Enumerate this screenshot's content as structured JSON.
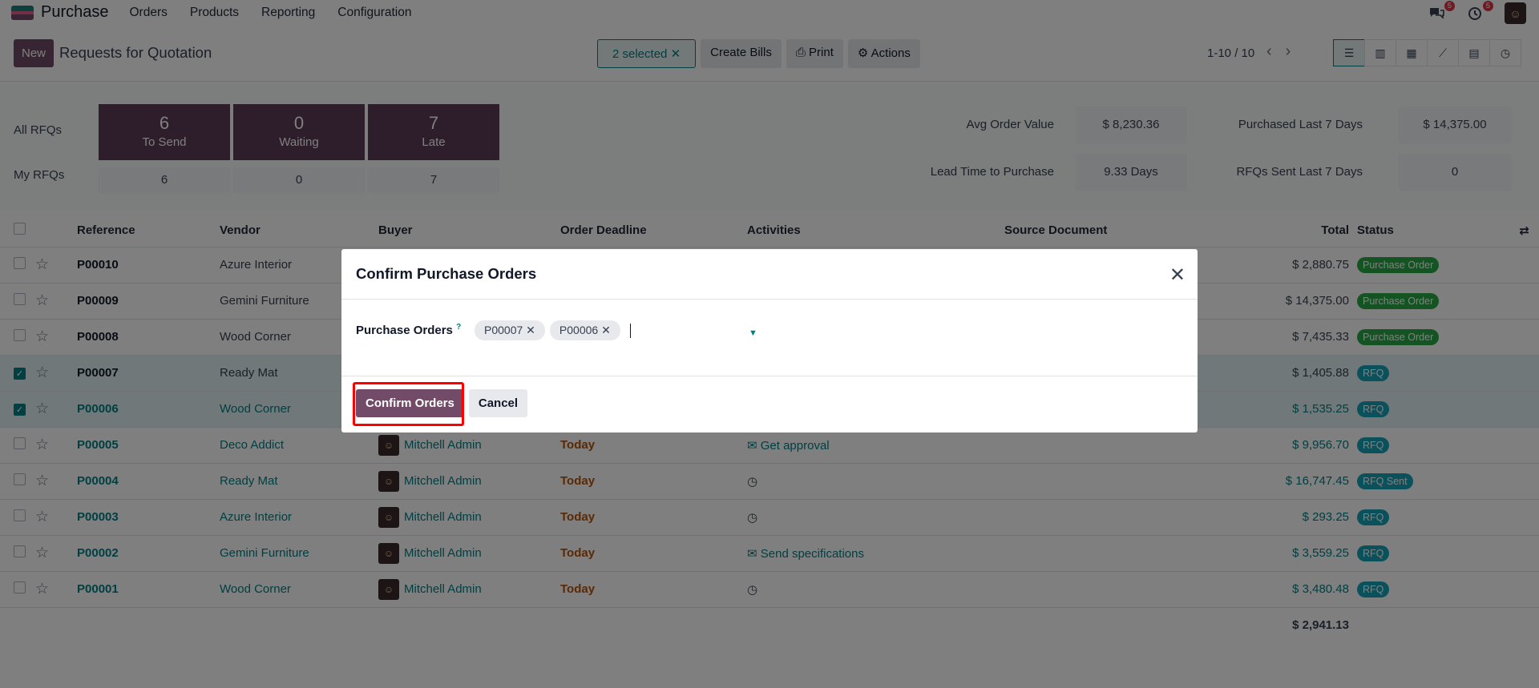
{
  "topbar": {
    "app_name": "Purchase",
    "menu": [
      "Orders",
      "Products",
      "Reporting",
      "Configuration"
    ],
    "chat_badge": "5",
    "activity_badge": "5"
  },
  "control_panel": {
    "new_label": "New",
    "breadcrumb": "Requests for Quotation",
    "selected_label": "2 selected",
    "create_bills": "Create Bills",
    "print": "Print",
    "actions": "Actions",
    "pager": "1-10 / 10"
  },
  "dashboard": {
    "all_rfqs_label": "All RFQs",
    "my_rfqs_label": "My RFQs",
    "tiles": [
      {
        "count": "6",
        "label": "To Send",
        "mine": "6"
      },
      {
        "count": "0",
        "label": "Waiting",
        "mine": "0"
      },
      {
        "count": "7",
        "label": "Late",
        "mine": "7"
      }
    ],
    "stats": {
      "avg_order_label": "Avg Order Value",
      "avg_order_value": "$ 8,230.36",
      "purchased_label": "Purchased Last 7 Days",
      "purchased_value": "$ 14,375.00",
      "lead_time_label": "Lead Time to Purchase",
      "lead_time_value": "9.33 Days",
      "rfqs_sent_label": "RFQs Sent Last 7 Days",
      "rfqs_sent_value": "0"
    }
  },
  "table": {
    "headers": [
      "Reference",
      "Vendor",
      "Buyer",
      "Order Deadline",
      "Activities",
      "Source Document",
      "Total",
      "Status"
    ],
    "rows": [
      {
        "ref": "P00010",
        "vendor": "Azure Interior",
        "buyer": "",
        "deadline": "",
        "activity": "",
        "total": "$ 2,880.75",
        "status": "Purchase Order"
      },
      {
        "ref": "P00009",
        "vendor": "Gemini Furniture",
        "buyer": "",
        "deadline": "",
        "activity": "",
        "total": "$ 14,375.00",
        "status": "Purchase Order"
      },
      {
        "ref": "P00008",
        "vendor": "Wood Corner",
        "buyer": "",
        "deadline": "",
        "activity": "",
        "total": "$ 7,435.33",
        "status": "Purchase Order"
      },
      {
        "ref": "P00007",
        "vendor": "Ready Mat",
        "buyer": "",
        "deadline": "",
        "activity": "",
        "total": "$ 1,405.88",
        "status": "RFQ"
      },
      {
        "ref": "P00006",
        "vendor": "Wood Corner",
        "buyer": "",
        "deadline": "",
        "activity": "",
        "total": "$ 1,535.25",
        "status": "RFQ"
      },
      {
        "ref": "P00005",
        "vendor": "Deco Addict",
        "buyer": "Mitchell Admin",
        "deadline": "Today",
        "activity": "Get approval",
        "total": "$ 9,956.70",
        "status": "RFQ"
      },
      {
        "ref": "P00004",
        "vendor": "Ready Mat",
        "buyer": "Mitchell Admin",
        "deadline": "Today",
        "activity": "",
        "total": "$ 16,747.45",
        "status": "RFQ Sent"
      },
      {
        "ref": "P00003",
        "vendor": "Azure Interior",
        "buyer": "Mitchell Admin",
        "deadline": "Today",
        "activity": "",
        "total": "$ 293.25",
        "status": "RFQ"
      },
      {
        "ref": "P00002",
        "vendor": "Gemini Furniture",
        "buyer": "Mitchell Admin",
        "deadline": "Today",
        "activity": "Send specifications",
        "total": "$ 3,559.25",
        "status": "RFQ"
      },
      {
        "ref": "P00001",
        "vendor": "Wood Corner",
        "buyer": "Mitchell Admin",
        "deadline": "Today",
        "activity": "",
        "total": "$ 3,480.48",
        "status": "RFQ"
      }
    ],
    "grand_total": "$ 2,941.13"
  },
  "modal": {
    "title": "Confirm Purchase Orders",
    "field_label": "Purchase Orders",
    "help_mark": "?",
    "tags": [
      "P00007",
      "P00006"
    ],
    "confirm_label": "Confirm Orders",
    "cancel_label": "Cancel"
  }
}
